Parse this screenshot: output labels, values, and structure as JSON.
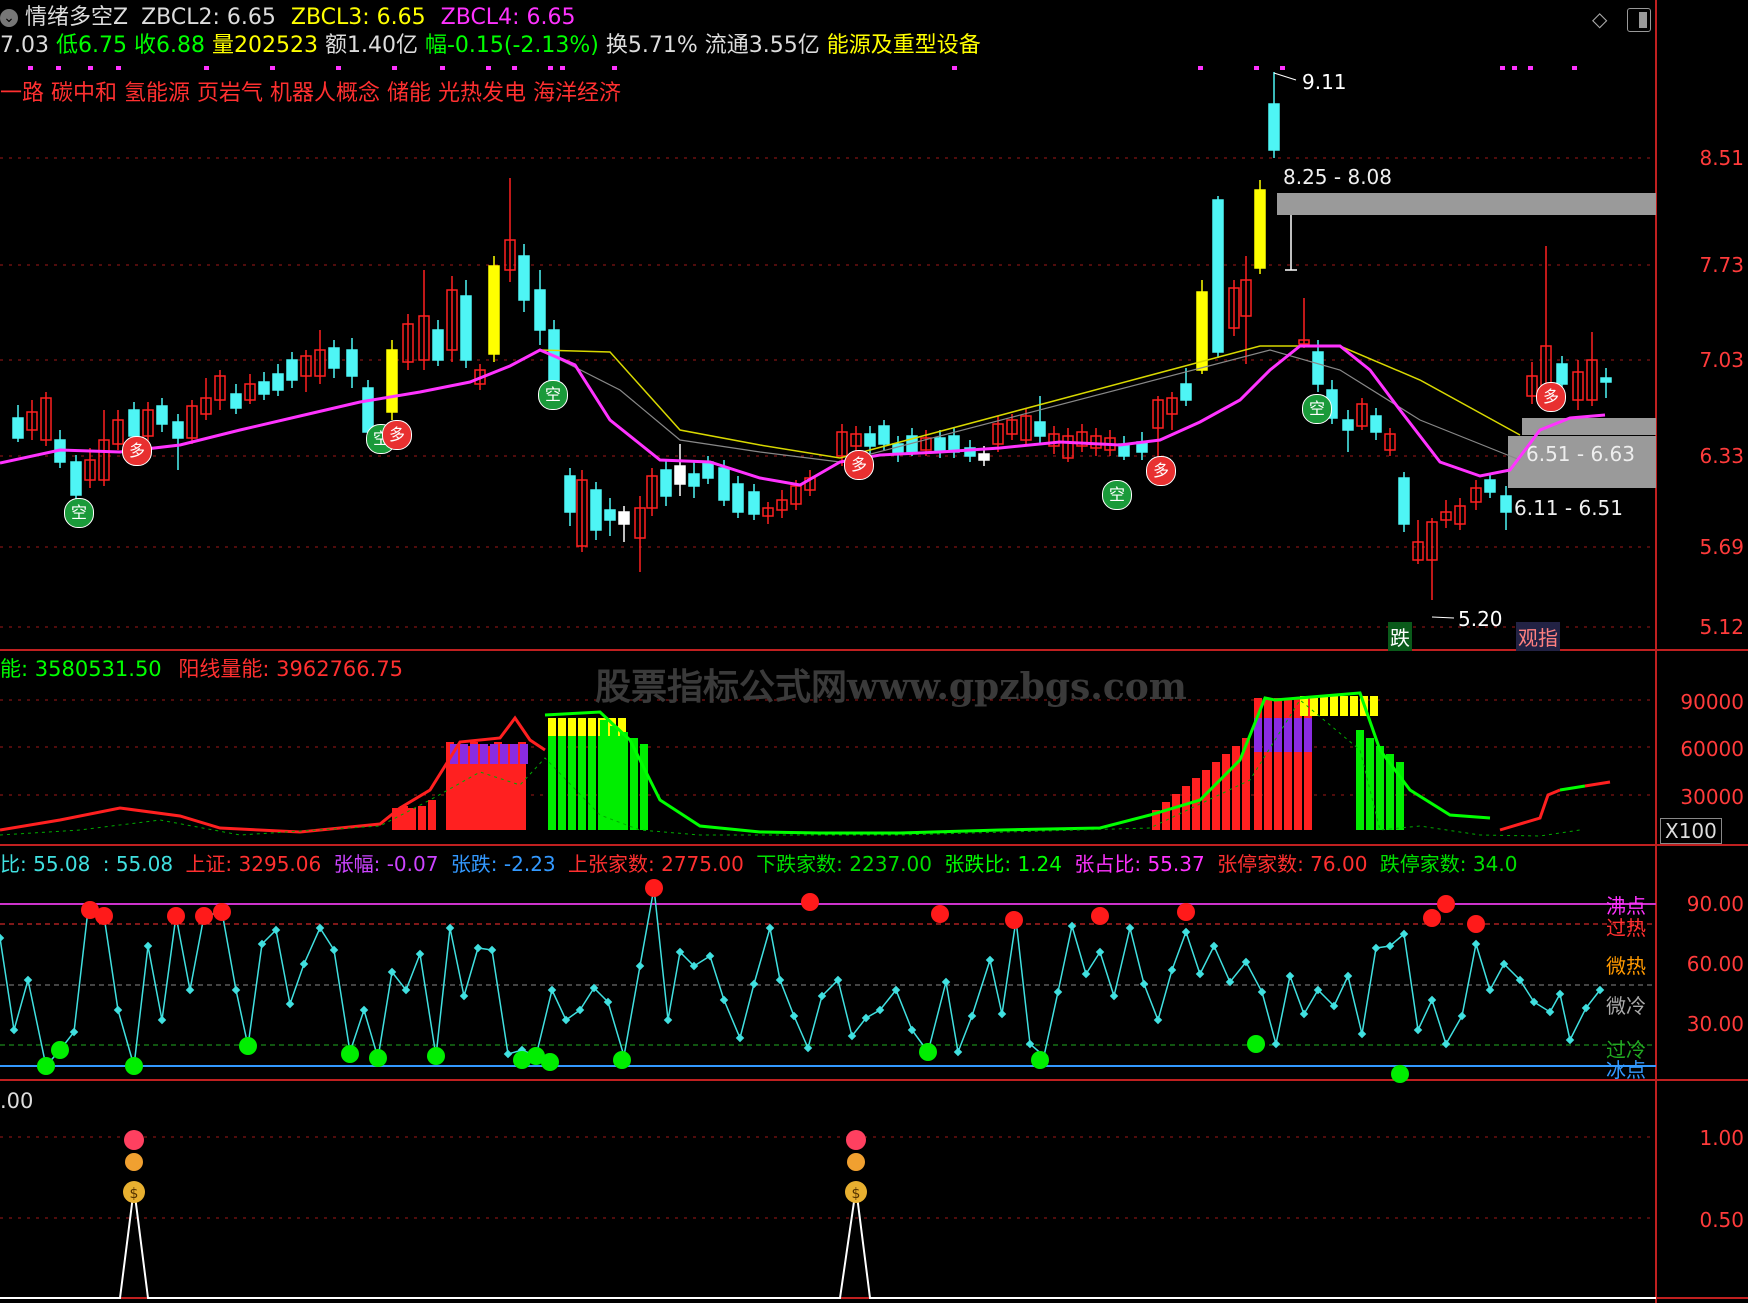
{
  "header": {
    "dropdown_icon": "chevron-down-icon",
    "indicator_name": "情绪多空Z",
    "zbcl2": "ZBCL2: 6.65",
    "zbcl3": "ZBCL3: 6.65",
    "zbcl4": "ZBCL4: 6.65",
    "icons": [
      "diamond-icon",
      "panel-toggle-icon"
    ]
  },
  "quote": {
    "open": "7.03",
    "low": "低6.75",
    "close": "收6.88",
    "volume": "量202523",
    "amount": "额1.40亿",
    "change": "幅-0.15(-2.13%)",
    "turnover": "换5.71%",
    "float": "流通3.55亿",
    "industry": "能源及重型设备"
  },
  "concepts": "一路 碳中和 氢能源 页岩气 机器人概念 储能 光热发电 海洋经济",
  "main_chart": {
    "y_ticks": [
      "8.51",
      "7.73",
      "7.03",
      "6.33",
      "5.69",
      "5.12"
    ],
    "high_label": "9.11",
    "low_label": "5.20",
    "zones": [
      "8.25 - 8.08",
      "6.51 - 6.63",
      "6.11 - 6.51"
    ],
    "tags": [
      "跌",
      "观指"
    ],
    "badge_bull": "多",
    "badge_bear": "空"
  },
  "volume_panel": {
    "title_left": "能: 3580531.50",
    "title_right": "阳线量能: 3962766.75",
    "y_ticks": [
      "90000",
      "60000",
      "30000"
    ],
    "multiplier": "X100"
  },
  "breadth_panel": {
    "items": [
      "比: 55.08",
      ": 55.08",
      "上证: 3295.06",
      "张幅: -0.07",
      "张跌: -2.23",
      "上张家数: 2775.00",
      "下跌家数: 2237.00",
      "张跌比: 1.24",
      "张占比: 55.37",
      "张停家数: 76.00",
      "跌停家数: 34.0"
    ],
    "y_ticks": [
      "90.00",
      "60.00",
      "30.00"
    ],
    "levels": [
      "沸点",
      "过热",
      "微热",
      "微冷",
      "过冷",
      "冰点"
    ]
  },
  "signal_panel": {
    "title": ".00",
    "y_ticks": [
      "1.00",
      "0.50"
    ]
  },
  "watermark": "股票指标公式网www.gpzbgs.com",
  "colors": {
    "up": "#ff2020",
    "down": "#4ef5f5",
    "ma": "#ff33ff",
    "grid": "#c02020",
    "yellow": "#ffff00",
    "green": "#00ff00"
  }
}
